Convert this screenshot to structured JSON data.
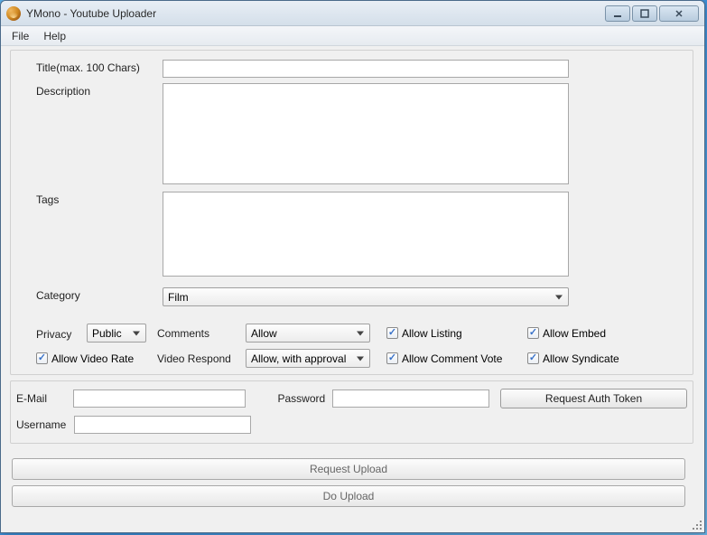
{
  "window": {
    "title": "YMono - Youtube Uploader"
  },
  "menu": {
    "file": "File",
    "help": "Help"
  },
  "labels": {
    "title_field": "Title(max. 100 Chars)",
    "description": "Description",
    "tags": "Tags",
    "category": "Category",
    "privacy": "Privacy",
    "comments": "Comments",
    "video_respond": "Video Respond",
    "allow_video_rate": "Allow Video Rate",
    "allow_listing": "Allow Listing",
    "allow_comment_vote": "Allow Comment Vote",
    "allow_embed": "Allow Embed",
    "allow_syndicate": "Allow Syndicate",
    "email": "E-Mail",
    "password": "Password",
    "username": "Username"
  },
  "values": {
    "title": "",
    "description": "",
    "tags": "",
    "category": "Film",
    "privacy": "Public",
    "comments": "Allow",
    "video_respond": "Allow, with approval",
    "email": "",
    "password": "",
    "username": ""
  },
  "checkboxes": {
    "allow_video_rate": true,
    "allow_listing": true,
    "allow_comment_vote": true,
    "allow_embed": true,
    "allow_syndicate": true
  },
  "buttons": {
    "request_auth": "Request Auth Token",
    "request_upload": "Request Upload",
    "do_upload": "Do Upload"
  }
}
